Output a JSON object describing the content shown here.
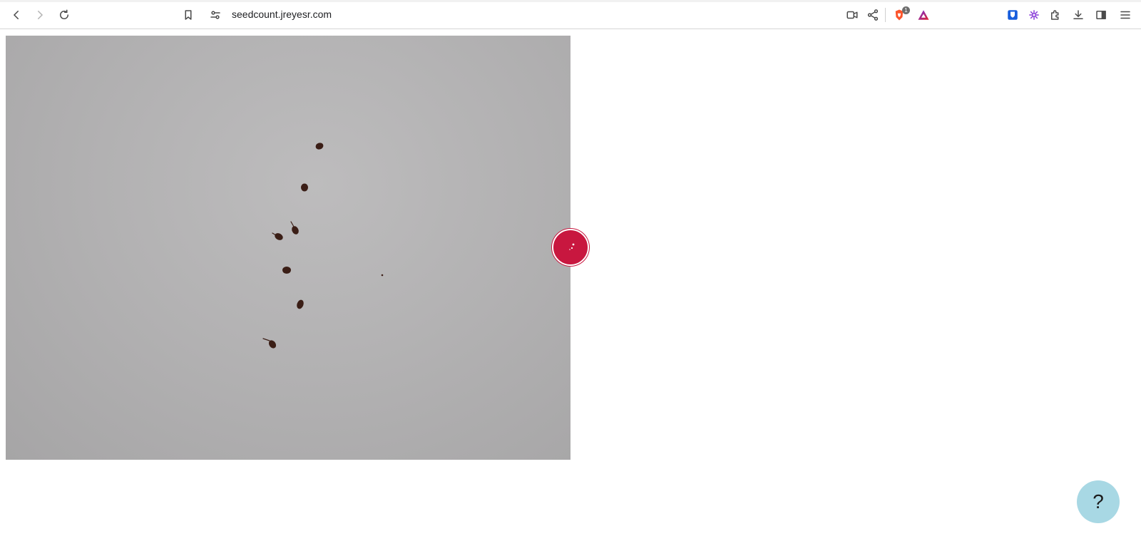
{
  "browser": {
    "url": "seedcount.jreyesr.com",
    "icons": {
      "back": "arrow-left-icon",
      "forward": "arrow-right-icon",
      "reload": "reload-icon",
      "bookmark": "bookmark-icon",
      "site_info": "site-settings-icon",
      "camera": "video-camera-icon",
      "share": "share-icon",
      "brave_shields": "brave-lion-icon",
      "brave_rewards": "triangle-icon",
      "bitwarden": "shield-icon",
      "extension_flower": "flower-icon",
      "extensions": "puzzle-icon",
      "downloads": "download-icon",
      "sidebar": "sidebar-icon",
      "menu": "hamburger-menu-icon"
    },
    "shields_badge": "1"
  },
  "page": {
    "image_alt_semantic": "seeds-photo",
    "seed_count_visible": 7,
    "fab_color": "#c8173f",
    "help_label": "?"
  }
}
